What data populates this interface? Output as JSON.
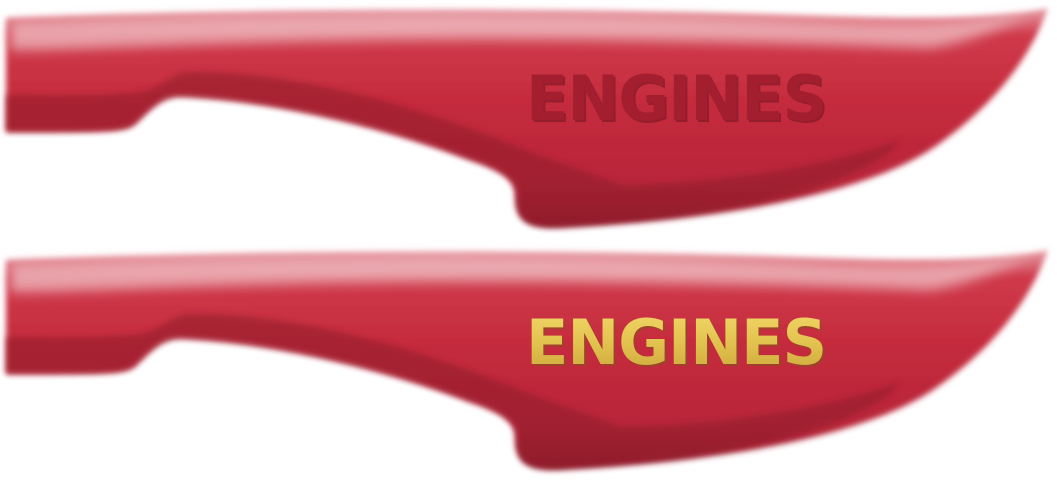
{
  "panels": [
    {
      "variant": "debossed",
      "label": "ENGINES",
      "colors": {
        "body": "#c42a3c",
        "body_dark": "#8f1d2b",
        "highlight": "#f2c4c9",
        "label_fill": "#a31f30",
        "label_shadow": "#6f1420"
      }
    },
    {
      "variant": "gold",
      "label": "ENGINES",
      "colors": {
        "body": "#c42a3c",
        "body_dark": "#8f1d2b",
        "highlight": "#f2c4c9",
        "label_fill": "#e3c34f",
        "label_shadow": "#7a5a14"
      }
    }
  ]
}
